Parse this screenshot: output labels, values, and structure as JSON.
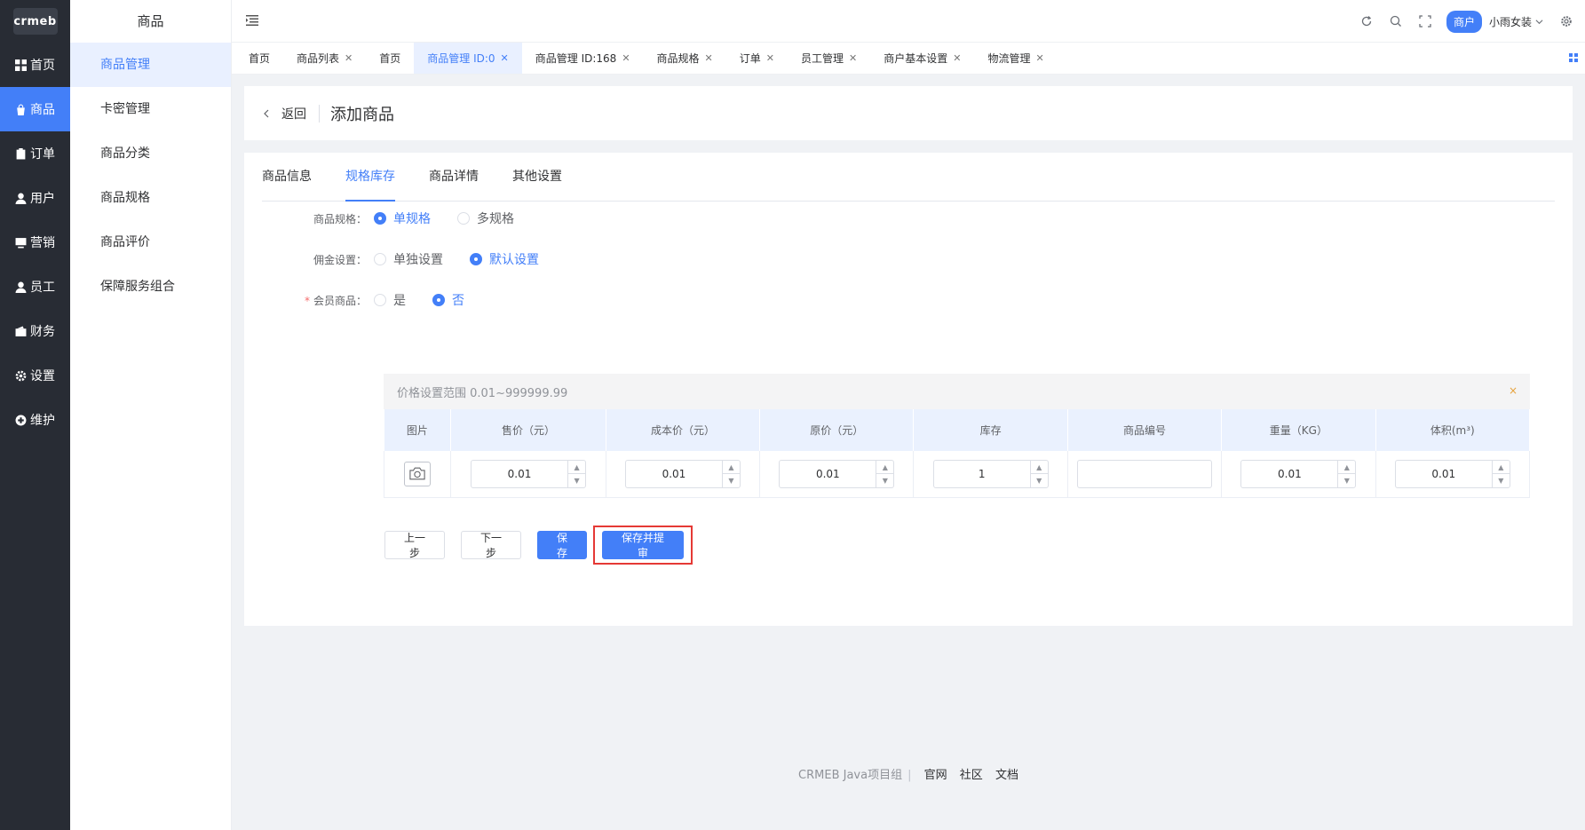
{
  "logo": "crmeb",
  "rail": [
    {
      "label": "首页",
      "icon": "grid-icon"
    },
    {
      "label": "商品",
      "icon": "bag-icon"
    },
    {
      "label": "订单",
      "icon": "clipboard-icon"
    },
    {
      "label": "用户",
      "icon": "user-icon"
    },
    {
      "label": "营销",
      "icon": "monitor-icon"
    },
    {
      "label": "员工",
      "icon": "user-icon"
    },
    {
      "label": "财务",
      "icon": "wallet-icon"
    },
    {
      "label": "设置",
      "icon": "gear-icon"
    },
    {
      "label": "维护",
      "icon": "plus-circle-icon"
    }
  ],
  "submenu": {
    "title": "商品",
    "items": [
      "商品管理",
      "卡密管理",
      "商品分类",
      "商品规格",
      "商品评价",
      "保障服务组合"
    ]
  },
  "header": {
    "merchant_badge": "商户",
    "user": "小雨女装"
  },
  "tabs": [
    "首页",
    "商品列表",
    "首页",
    "商品管理 ID:0",
    "商品管理 ID:168",
    "商品规格",
    "订单",
    "员工管理",
    "商户基本设置",
    "物流管理"
  ],
  "page": {
    "back": "返回",
    "title": "添加商品"
  },
  "inner_tabs": [
    "商品信息",
    "规格库存",
    "商品详情",
    "其他设置"
  ],
  "form": {
    "spec_label": "商品规格：",
    "spec_options": [
      "单规格",
      "多规格"
    ],
    "commission_label": "佣金设置：",
    "commission_options": [
      "单独设置",
      "默认设置"
    ],
    "member_label": "会员商品：",
    "member_required": "*",
    "member_options": [
      "是",
      "否"
    ]
  },
  "notice": {
    "text": "价格设置范围 0.01~999999.99",
    "close": "×"
  },
  "table": {
    "headers": [
      "图片",
      "售价（元）",
      "成本价（元）",
      "原价（元）",
      "库存",
      "商品编号",
      "重量（KG）",
      "体积(m³)"
    ],
    "row": {
      "price": "0.01",
      "cost": "0.01",
      "original": "0.01",
      "stock": "1",
      "sku": "",
      "weight": "0.01",
      "volume": "0.01"
    }
  },
  "buttons": {
    "prev": "上一步",
    "next": "下一步",
    "save": "保存",
    "save_submit": "保存并提审"
  },
  "footer": {
    "text": "CRMEB Java项目组",
    "links": [
      "官网",
      "社区",
      "文档"
    ]
  },
  "colors": {
    "primary": "#437ff8",
    "sidebar": "#282c34",
    "highlight": "#e53935"
  }
}
